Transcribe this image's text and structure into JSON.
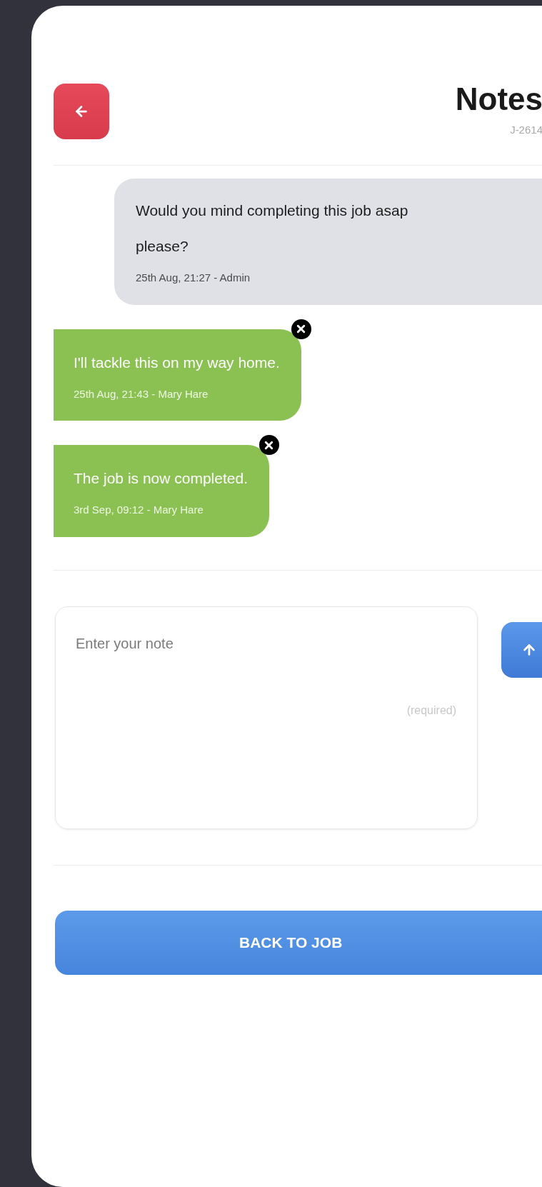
{
  "header": {
    "title": "Notes",
    "subtitle": "J-2614"
  },
  "messages": [
    {
      "kind": "received",
      "text": "Would you mind completing this job asap please?",
      "meta": "25th Aug, 21:27 - Admin",
      "deletable": false
    },
    {
      "kind": "sent",
      "text": "I'll tackle this on my way home.",
      "meta": "25th Aug, 21:43 - Mary Hare",
      "deletable": true
    },
    {
      "kind": "sent",
      "text": "The job is now completed.",
      "meta": "3rd Sep, 09:12 - Mary Hare",
      "deletable": true
    }
  ],
  "composer": {
    "placeholder": "Enter your note",
    "hint": "(required)"
  },
  "primary_button": "BACK TO JOB"
}
